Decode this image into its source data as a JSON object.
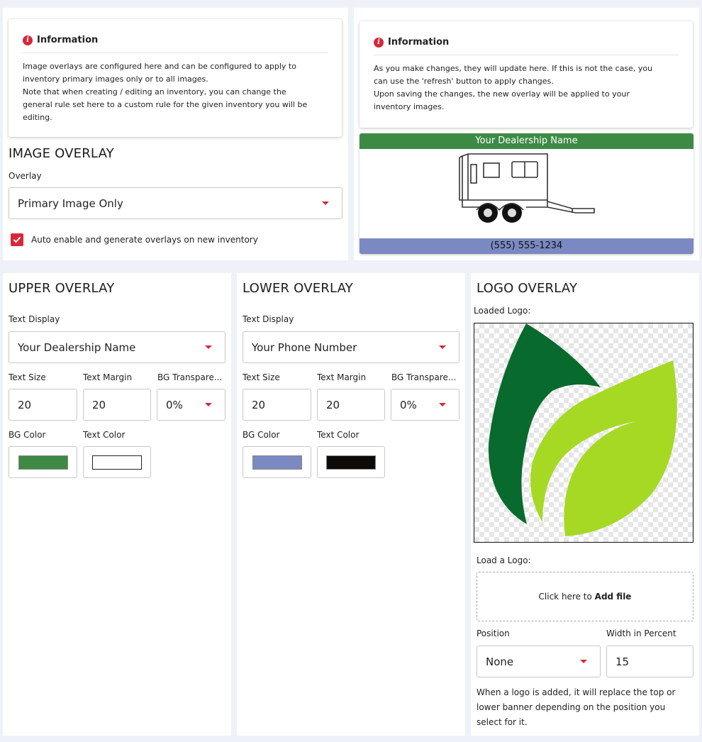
{
  "image_overlay_section": {
    "info": {
      "title": "Information",
      "line1": "Image overlays are configured here and can be configured to apply to",
      "line2": "inventory primary images only or to all images.",
      "line3": "Note that when creating / editing an inventory, you can change the",
      "line4": "general rule set here to a custom rule for the given inventory you will be",
      "line5": "editing."
    },
    "heading": "IMAGE OVERLAY",
    "overlay_label": "Overlay",
    "overlay_value": "Primary Image Only",
    "auto_enable_label": "Auto enable and generate overlays on new inventory",
    "auto_enable_checked": true
  },
  "preview_section": {
    "info": {
      "title": "Information",
      "line1": "As you make changes, they will update here. If this is not the case, you",
      "line2": "can use the 'refresh' button to apply changes.",
      "line3": "Upon saving the changes, the new overlay will be applied to your",
      "line4": "inventory images."
    },
    "top_banner_text": "Your Dealership Name",
    "bottom_banner_text": "(555) 555-1234",
    "top_banner_color": "#3d8a45",
    "bottom_banner_color": "#7b89c2"
  },
  "upper_overlay": {
    "heading": "UPPER OVERLAY",
    "text_display_label": "Text Display",
    "text_display_value": "Your Dealership Name",
    "text_size_label": "Text Size",
    "text_size_value": "20",
    "text_margin_label": "Text Margin",
    "text_margin_value": "20",
    "bg_transparency_label": "BG Transpare...",
    "bg_transparency_value": "0%",
    "bg_color_label": "BG Color",
    "bg_color": "#3d8a45",
    "text_color_label": "Text Color",
    "text_color": "#ffffff"
  },
  "lower_overlay": {
    "heading": "LOWER OVERLAY",
    "text_display_label": "Text Display",
    "text_display_value": "Your Phone Number",
    "text_size_label": "Text Size",
    "text_size_value": "20",
    "text_margin_label": "Text Margin",
    "text_margin_value": "20",
    "bg_transparency_label": "BG Transpare...",
    "bg_transparency_value": "0%",
    "bg_color_label": "BG Color",
    "bg_color": "#7b89c2",
    "text_color_label": "Text Color",
    "text_color": "#0e0a08"
  },
  "logo_overlay": {
    "heading": "LOGO OVERLAY",
    "loaded_logo_label": "Loaded Logo:",
    "load_logo_label": "Load a Logo:",
    "dropzone_prefix": "Click here to ",
    "dropzone_action": "Add file",
    "position_label": "Position",
    "position_value": "None",
    "width_label": "Width in Percent",
    "width_value": "15",
    "help_line1": "When a logo is added, it will replace the top or",
    "help_line2": "lower banner depending on the position you",
    "help_line3": "select for it.",
    "logo_dark_color": "#086a2c",
    "logo_light_color": "#a6d924"
  },
  "colors": {
    "accent": "#d6283b",
    "page_background": "#eef1f8"
  }
}
